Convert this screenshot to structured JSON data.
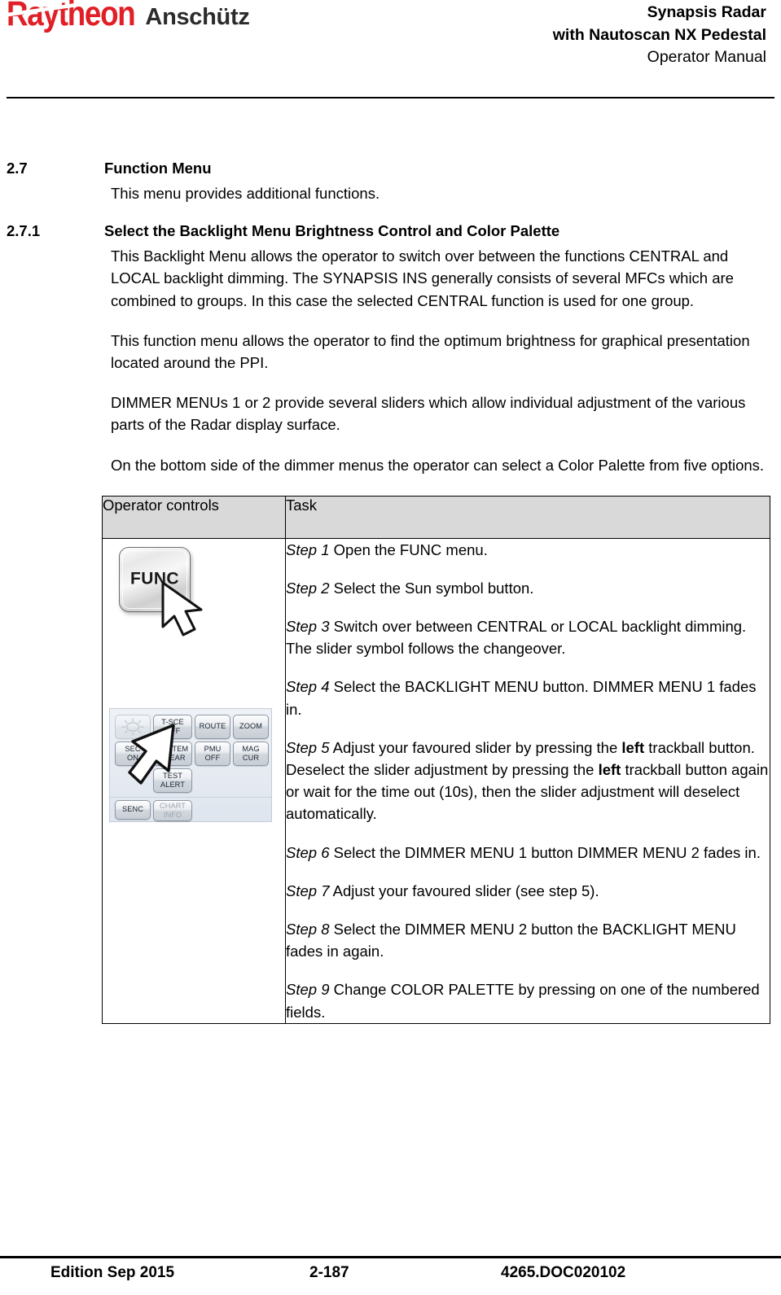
{
  "header": {
    "logo_primary": "Raytheon",
    "logo_secondary": "Anschütz",
    "title_line1": "Synapsis Radar",
    "title_line2": "with Nautoscan NX Pedestal",
    "title_line3": "Operator Manual"
  },
  "sections": [
    {
      "number": "2.7",
      "title": "Function Menu",
      "intro": "This menu provides additional functions."
    },
    {
      "number": "2.7.1",
      "title": "Select the Backlight Menu Brightness Control and Color Palette",
      "paragraphs": [
        "This Backlight Menu allows the operator to switch over between the functions CENTRAL and LOCAL backlight dimming. The SYNAPSIS INS generally consists of several MFCs which are combined to groups. In this case the selected CENTRAL function is used for one group.",
        "This function menu allows the operator to find the optimum brightness for graphical presentation located around the PPI.",
        "DIMMER MENUs 1 or 2 provide several sliders which allow individual adjustment of the various parts of the Radar display surface.",
        "On the bottom side of the dimmer menus the operator can select a Color Palette from five options."
      ]
    }
  ],
  "table": {
    "headers": [
      "Operator controls",
      "Task"
    ],
    "operator_controls": {
      "func_button_label": "FUNC",
      "cursor_icon": "arrow-pointer-icon",
      "menu_panel": {
        "row1": [
          {
            "label": "",
            "icon": "sun-icon",
            "faded": true
          },
          {
            "label": "T-SCE\nOFF",
            "line1": "T-SCE",
            "line2": "OFF"
          },
          {
            "label": "ROUTE",
            "line1": "ROUTE",
            "line2": ""
          },
          {
            "label": "ZOOM",
            "line1": "ZOOM",
            "line2": ""
          }
        ],
        "row2": [
          {
            "line1": "SEC",
            "line2": "ON"
          },
          {
            "line1": "SYSTEM",
            "line2": "CLEAR"
          },
          {
            "line1": "PMU",
            "line2": "OFF"
          },
          {
            "line1": "MAG",
            "line2": "CUR"
          }
        ],
        "row3": [
          {
            "line1": "TEST",
            "line2": "ALERT"
          }
        ],
        "row4": [
          {
            "line1": "SENC",
            "line2": "",
            "disabled": false
          },
          {
            "line1": "CHART",
            "line2": "INFO",
            "disabled": true
          }
        ]
      }
    },
    "steps": [
      {
        "label": "Step 1",
        "label_italic_number": true,
        "text": " Open the FUNC menu."
      },
      {
        "label": "Step 2",
        "label_italic_number": true,
        "text": " Select the Sun symbol button."
      },
      {
        "label": "Step 3",
        "label_italic_number": true,
        "text": " Switch over between CENTRAL or LOCAL backlight dimming. The slider symbol follows the changeover."
      },
      {
        "label": "Step 4",
        "label_italic_number": true,
        "text": " Select the BACKLIGHT MENU button. DIMMER MENU 1 fades in."
      },
      {
        "label": "Step 5",
        "label_italic_number": true,
        "text_part1": " Adjust your favoured slider by pressing the ",
        "bold1": "left",
        "text_part2": " trackball button. Deselect the slider adjustment by pressing the ",
        "bold2": "left",
        "text_part3": " trackball button again or wait for the time out (10s), then the slider adjustment will deselect automatically."
      },
      {
        "label": "Step 6",
        "label_italic_number": true,
        "text": " Select the DIMMER MENU 1 button DIMMER MENU 2 fades in."
      },
      {
        "label": "Step 7",
        "label_italic_number": false,
        "text": " Adjust your favoured slider (see step 5)."
      },
      {
        "label": "Step 8",
        "label_italic_number": true,
        "text": " Select the DIMMER MENU 2 button the BACKLIGHT MENU fades in again."
      },
      {
        "label": "Step 9",
        "label_italic_number": true,
        "text": " Change COLOR PALETTE by pressing on one of the numbered fields."
      }
    ]
  },
  "footer": {
    "edition": "Edition Sep 2015",
    "page": "2-187",
    "doc_id": "4265.DOC020102"
  },
  "colors": {
    "brand_red": "#e01f26",
    "table_header_bg": "#d9d9d9",
    "text": "#000000"
  }
}
